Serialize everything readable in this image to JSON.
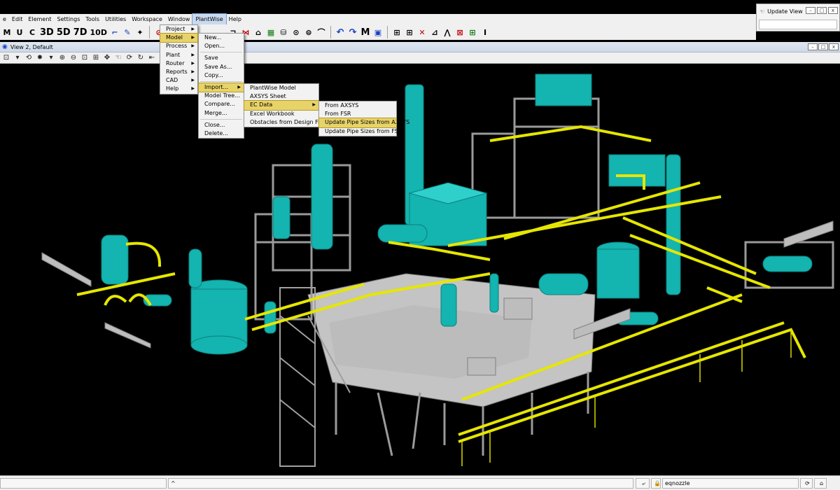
{
  "menubar": {
    "items": [
      "e",
      "Edit",
      "Element",
      "Settings",
      "Tools",
      "Utilities",
      "Workspace",
      "Window",
      "PlantWise",
      "Help"
    ]
  },
  "toolbar1": {
    "buttons": [
      "M",
      "U",
      "C",
      "3D",
      "5D",
      "7D",
      "10D"
    ]
  },
  "update_view": {
    "title": "Update View",
    "min": "–",
    "restore": "□",
    "close": "x"
  },
  "view": {
    "title": "View 2, Default"
  },
  "plantwise_menu": {
    "items": [
      "Project",
      "Model",
      "Process",
      "Plant",
      "Router",
      "Reports",
      "CAD",
      "Help"
    ]
  },
  "model_submenu": {
    "items": [
      "New...",
      "Open...",
      "Save",
      "Save As...",
      "Copy...",
      "Import...",
      "Model Tree...",
      "Compare...",
      "Merge...",
      "Close...",
      "Delete..."
    ]
  },
  "import_submenu": {
    "items": [
      "PlantWise Model",
      "AXSYS Sheet",
      "EC Data",
      "Excel Workbook",
      "Obstacles from Design Files"
    ]
  },
  "ecdata_submenu": {
    "items": [
      "From AXSYS",
      "From FSR",
      "Update Pipe Sizes from AXSYS",
      "Update Pipe Sizes from FSR"
    ]
  },
  "statusbar": {
    "element_field": "eqnozzle",
    "caret": "^"
  },
  "colors": {
    "equipment": "#14b4b0",
    "pipe": "#e6e600",
    "structure": "#9a9a9a",
    "platform": "#c4c4c4",
    "background": "#000000"
  }
}
